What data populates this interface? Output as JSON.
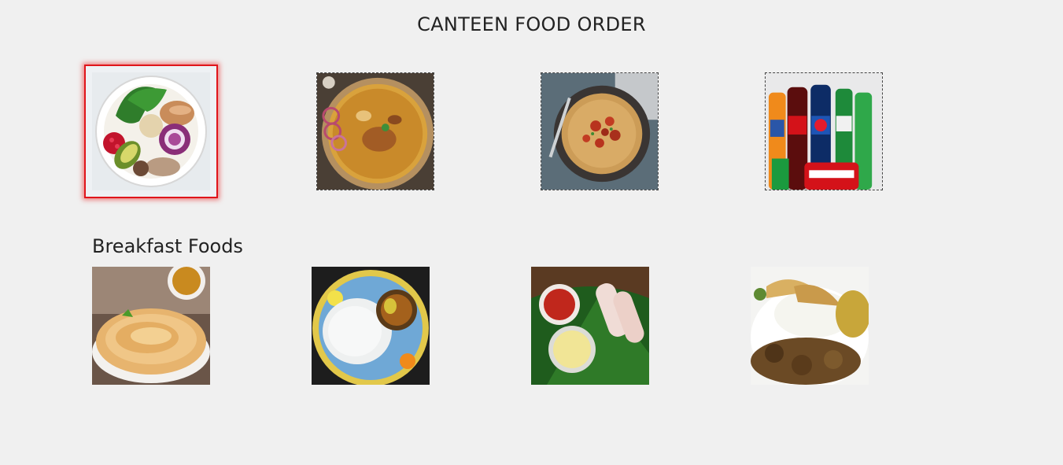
{
  "page": {
    "title": "CANTEEN FOOD ORDER"
  },
  "featured_items": [
    {
      "name": "salad-bowl",
      "selected": true
    },
    {
      "name": "biryani",
      "selected": false
    },
    {
      "name": "spaghetti",
      "selected": false
    },
    {
      "name": "soft-drinks",
      "selected": false
    }
  ],
  "breakfast": {
    "heading": "Breakfast Foods",
    "items": [
      {
        "name": "parotta"
      },
      {
        "name": "idiyappam"
      },
      {
        "name": "puttu"
      },
      {
        "name": "rice-curry"
      }
    ]
  },
  "colors": {
    "background": "#f0f0f0",
    "selection_outline": "#e0151b"
  }
}
